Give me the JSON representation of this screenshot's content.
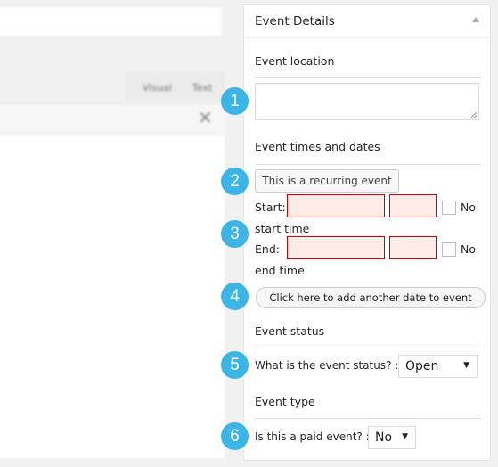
{
  "editor": {
    "tabs": [
      "Visual",
      "Text"
    ],
    "close_icon": "close-icon"
  },
  "panel": {
    "title": "Event Details",
    "collapse_icon": "triangle-up-icon",
    "location": {
      "heading": "Event location",
      "value": ""
    },
    "times": {
      "heading": "Event times and dates",
      "recurring_button": "This is a recurring event",
      "start_label": "Start:",
      "end_label": "End:",
      "no_start_time": [
        "No",
        "start time"
      ],
      "no_end_time": [
        "No",
        "end time"
      ],
      "add_date_button": "Click here to add another date to event"
    },
    "status": {
      "heading": "Event status",
      "question": "What is the event status? :",
      "selected": "Open"
    },
    "type": {
      "heading": "Event type",
      "question": "Is this a paid event? :",
      "selected": "No"
    }
  },
  "badges": [
    "1",
    "2",
    "3",
    "4",
    "5",
    "6"
  ],
  "colors": {
    "badge": "#3bb5e6",
    "invalid_border": "#cc0000",
    "invalid_bg": "#ffebe8"
  }
}
